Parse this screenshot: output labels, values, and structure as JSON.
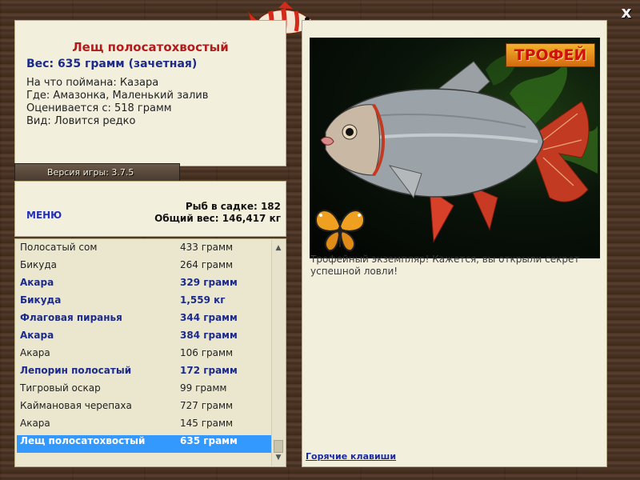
{
  "window": {
    "close_label": "x"
  },
  "fish": {
    "title": "Лещ полосатохвостый",
    "weight_line": "Вес: 635 грамм (зачетная)",
    "info": [
      "На что поймана: Казара",
      "Где: Амазонка, Маленький залив",
      "Оценивается с: 518 грамм",
      "Вид: Ловится редко"
    ]
  },
  "version": {
    "label": "Версия игры: 3.7.5"
  },
  "menu": {
    "label": "МЕНЮ"
  },
  "stats": {
    "fish_in_keepnet": "Рыб в садке: 182",
    "total_weight": "Общий вес: 146,417 кг"
  },
  "catch_list": [
    {
      "name": "Полосатый сом",
      "weight": "433 грамм",
      "bold": false,
      "selected": false
    },
    {
      "name": "Бикуда",
      "weight": "264 грамм",
      "bold": false,
      "selected": false
    },
    {
      "name": "Акара",
      "weight": "329 грамм",
      "bold": true,
      "selected": false
    },
    {
      "name": "Бикуда",
      "weight": "1,559 кг",
      "bold": true,
      "selected": false
    },
    {
      "name": "Флаговая пиранья",
      "weight": "344 грамм",
      "bold": true,
      "selected": false
    },
    {
      "name": "Акара",
      "weight": "384 грамм",
      "bold": true,
      "selected": false
    },
    {
      "name": "Акара",
      "weight": "106 грамм",
      "bold": false,
      "selected": false
    },
    {
      "name": "Лепорин полосатый",
      "weight": "172 грамм",
      "bold": true,
      "selected": false
    },
    {
      "name": "Тигровый оскар",
      "weight": "99 грамм",
      "bold": false,
      "selected": false
    },
    {
      "name": "Каймановая черепаха",
      "weight": "727 грамм",
      "bold": false,
      "selected": false
    },
    {
      "name": "Акара",
      "weight": "145 грамм",
      "bold": false,
      "selected": false
    },
    {
      "name": "Лещ полосатохвостый",
      "weight": "635 грамм",
      "bold": true,
      "selected": true
    }
  ],
  "image": {
    "trophy_label": "ТРОФЕЙ"
  },
  "description": "Трофейный экземпляр! Кажется, вы открыли секрет успешной ловли!",
  "hotkeys": {
    "label": "Горячие клавиши"
  },
  "colors": {
    "panel_bg": "#f3efdd",
    "title_red": "#b31c1c",
    "accent_blue": "#1c2b8a",
    "selection_blue": "#3399ff"
  }
}
